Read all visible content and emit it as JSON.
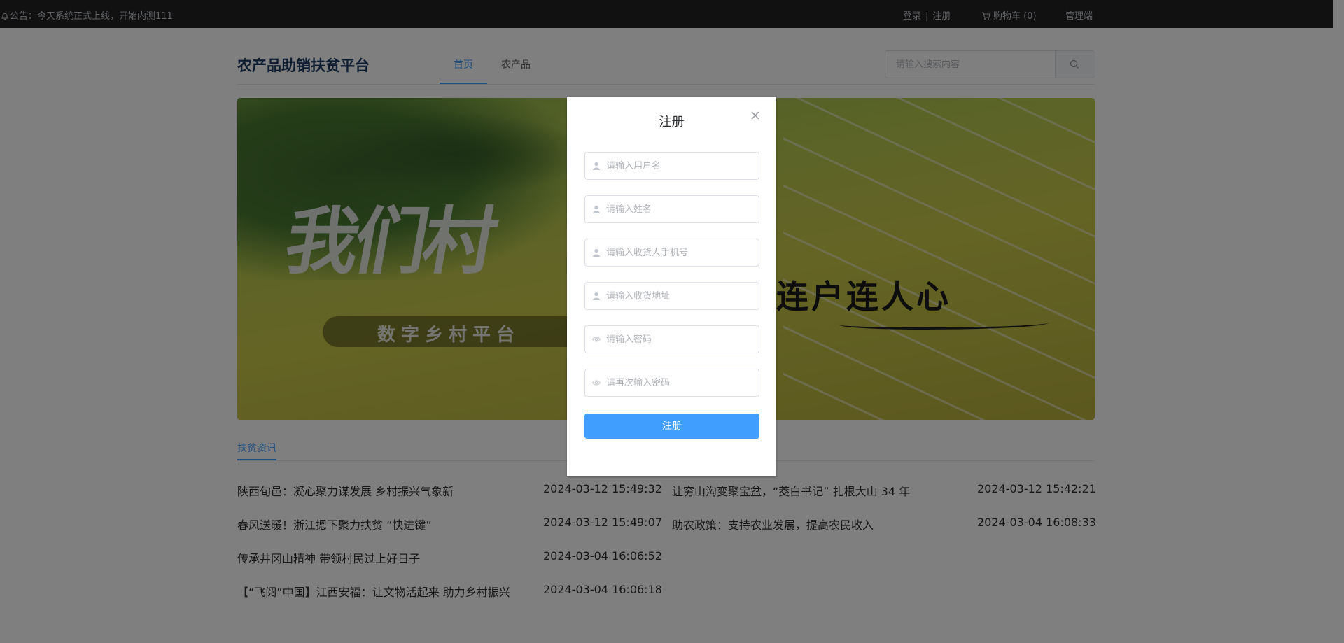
{
  "topbar": {
    "notice": "公告：今天系统正式上线，开始内测111",
    "login": "登录",
    "separator": "|",
    "register": "注册",
    "cart": "购物车 (0)",
    "admin": "管理端"
  },
  "header": {
    "logo": "农产品助销扶贫平台",
    "nav": [
      "首页",
      "农产品"
    ],
    "search_placeholder": "请输入搜索内容"
  },
  "banner": {
    "calligraphy": "我们村",
    "pill_text": "数字乡村平台",
    "slogan": "连户连人心"
  },
  "news": {
    "tab": "扶贫资讯",
    "left": [
      {
        "title": "陕西旬邑：凝心聚力谋发展 乡村振兴气象新",
        "date": "2024-03-12 15:49:32"
      },
      {
        "title": "春风送暖！浙江摁下聚力扶贫 “快进键”",
        "date": "2024-03-12 15:49:07"
      },
      {
        "title": "传承井冈山精神 带领村民过上好日子",
        "date": "2024-03-04 16:06:52"
      },
      {
        "title": "【“飞阅”中国】江西安福：让文物活起来 助力乡村振兴",
        "date": "2024-03-04 16:06:18"
      }
    ],
    "right": [
      {
        "title": "让穷山沟变聚宝盆，“茭白书记” 扎根大山 34 年",
        "date": "2024-03-12 15:42:21"
      },
      {
        "title": "助农政策：支持农业发展，提高农民收入",
        "date": "2024-03-04 16:08:33"
      }
    ]
  },
  "dialog": {
    "title": "注册",
    "fields": [
      {
        "placeholder": "请输入用户名",
        "icon": "user-icon"
      },
      {
        "placeholder": "请输入姓名",
        "icon": "user-icon"
      },
      {
        "placeholder": "请输入收货人手机号",
        "icon": "user-icon"
      },
      {
        "placeholder": "请输入收货地址",
        "icon": "user-icon"
      },
      {
        "placeholder": "请输入密码",
        "icon": "eye-icon"
      },
      {
        "placeholder": "请再次输入密码",
        "icon": "eye-icon"
      }
    ],
    "submit": "注册"
  },
  "colors": {
    "primary": "#409eff",
    "topbar_bg": "#222222",
    "overlay": "rgba(0,0,0,0.5)",
    "logo": "#1f3b63"
  }
}
